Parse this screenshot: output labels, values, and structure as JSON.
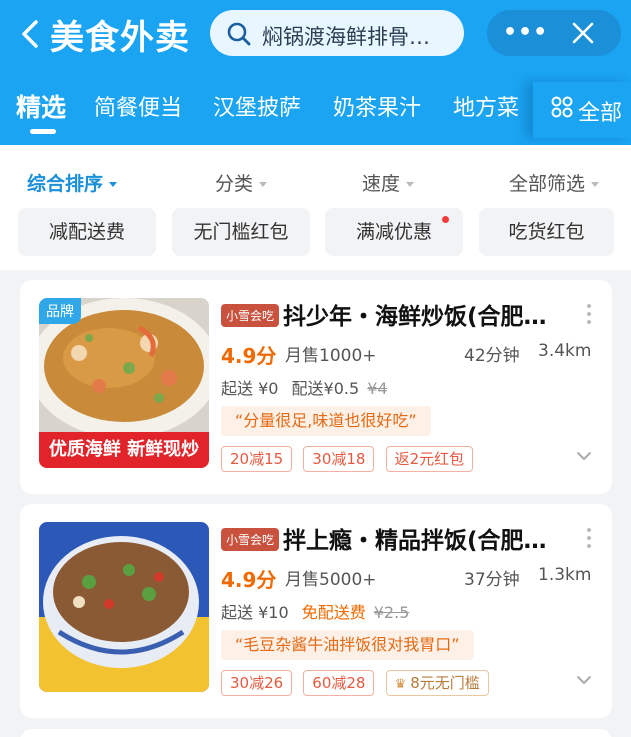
{
  "header": {
    "title": "美食外卖",
    "search_text": "焖锅渡海鲜排骨…",
    "more_label": "•••"
  },
  "tabs": {
    "items": [
      "精选",
      "简餐便当",
      "汉堡披萨",
      "奶茶果汁",
      "地方菜"
    ],
    "all_label": "全部"
  },
  "filters": {
    "sort_options": [
      "综合排序",
      "分类",
      "速度",
      "全部筛选"
    ],
    "chips": [
      "减配送费",
      "无门槛红包",
      "满减优惠",
      "吃货红包"
    ]
  },
  "stores": [
    {
      "brand_badge": "品牌",
      "banner": "优质海鲜 新鲜现炒",
      "member_tag": "小雪会吃",
      "name": "抖少年・海鲜炒饭(合肥…",
      "rating": "4.9分",
      "sales": "月售1000+",
      "eta": "42分钟",
      "distance": "3.4km",
      "min_order": "起送 ¥0",
      "delivery": "配送¥0.5",
      "delivery_original": "¥4",
      "review": "“分量很足,味道也很好吃”",
      "coupons": [
        "20减15",
        "30减18",
        "返2元红包"
      ]
    },
    {
      "member_tag": "小雪会吃",
      "name": "拌上瘾・精品拌饭(合肥…",
      "rating": "4.9分",
      "sales": "月售5000+",
      "eta": "37分钟",
      "distance": "1.3km",
      "min_order": "起送 ¥10",
      "delivery": "免配送费",
      "delivery_original": "¥2.5",
      "review": "“毛豆杂酱牛油拌饭很对我胃口”",
      "coupons": [
        "30减26",
        "60减28"
      ],
      "gold_coupon": "8元无门槛"
    }
  ],
  "colors": {
    "header_blue": "#1aa4f2",
    "accent_orange": "#f06a00",
    "coupon_red": "#e45a40"
  }
}
